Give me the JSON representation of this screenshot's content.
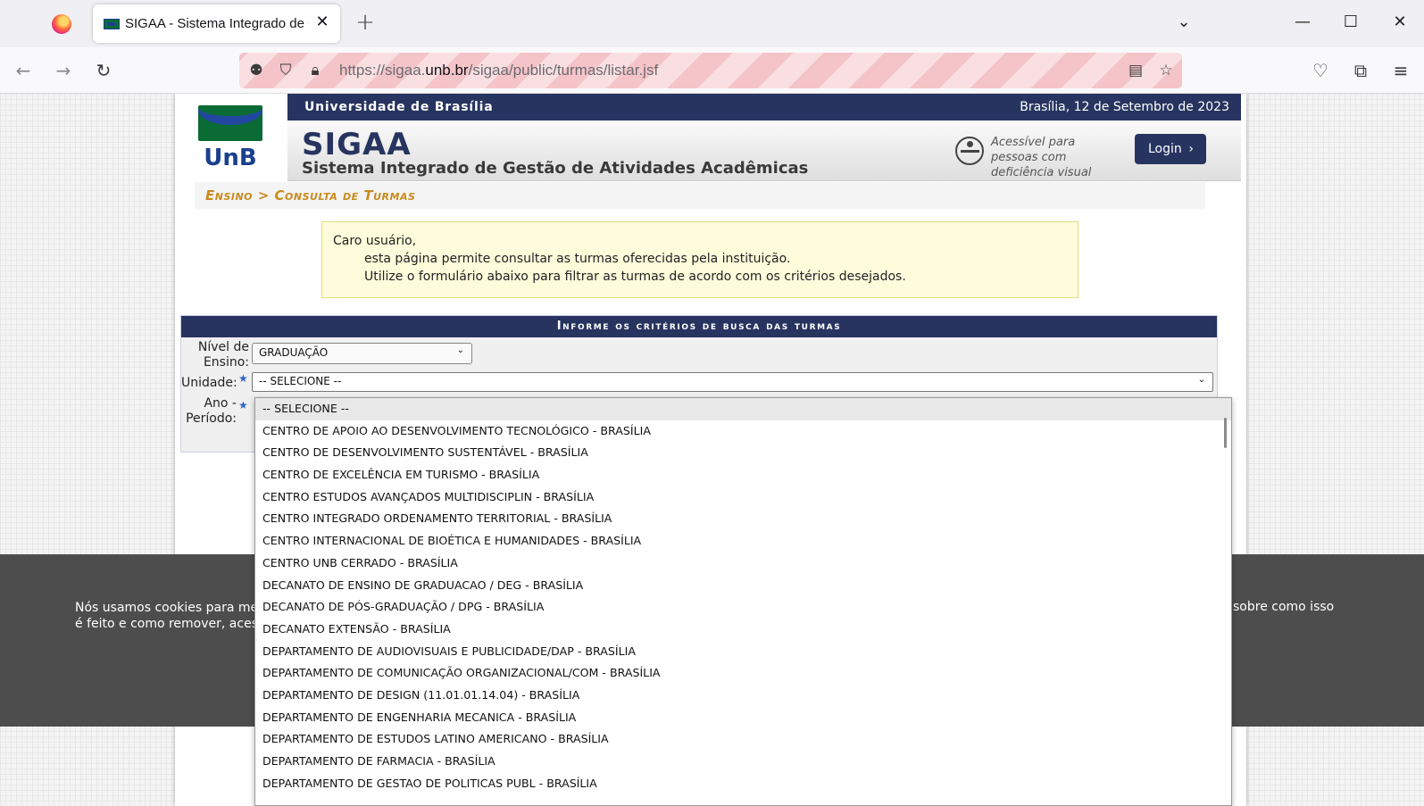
{
  "browser": {
    "tab_title": "SIGAA - Sistema Integrado de Gestão de Atividades Acadêmicas",
    "url_prefix": "https://sigaa.",
    "url_domain": "unb.br",
    "url_path": "/sigaa/public/turmas/listar.jsf"
  },
  "header": {
    "institution": "Universidade de Brasília",
    "date": "Brasília, 12 de Setembro de 2023",
    "logo_text": "UnB",
    "system_name": "SIGAA",
    "system_subtitle": "Sistema Integrado de Gestão de Atividades Acadêmicas",
    "accessibility_text": "Acessível para pessoas com deficiência visual",
    "login_label": "Login"
  },
  "breadcrumb": "Ensino > Consulta de Turmas",
  "notice": {
    "greeting": "Caro usuário,",
    "line1": "esta página permite consultar as turmas oferecidas pela instituição.",
    "line2": "Utilize o formulário abaixo para filtrar as turmas de acordo com os critérios desejados."
  },
  "form": {
    "title": "Informe os critérios de busca das turmas",
    "nivel_label_1": "Nível de",
    "nivel_label_2": "Ensino:",
    "nivel_value": "GRADUAÇÃO",
    "unidade_label": "Unidade:",
    "unidade_value": "-- SELECIONE --",
    "ano_label_1": "Ano -",
    "ano_label_2": "Período:"
  },
  "cookie": {
    "line1": "Nós usamos cookies para me",
    "line2": "é feito e como remover, aces",
    "tail": "sobre como isso"
  },
  "unidade_options": [
    "-- SELECIONE --",
    "CENTRO DE APOIO AO DESENVOLVIMENTO TECNOLÓGICO - BRASÍLIA",
    "CENTRO DE DESENVOLVIMENTO SUSTENTÁVEL - BRASÍLIA",
    "CENTRO DE EXCELÊNCIA EM TURISMO - BRASÍLIA",
    "CENTRO ESTUDOS AVANÇADOS MULTIDISCIPLIN - BRASÍLIA",
    "CENTRO INTEGRADO ORDENAMENTO TERRITORIAL - BRASÍLIA",
    "CENTRO INTERNACIONAL DE BIOÉTICA E HUMANIDADES - BRASÍLIA",
    "CENTRO UNB CERRADO - BRASÍLIA",
    "DECANATO DE ENSINO DE GRADUACAO / DEG - BRASÍLIA",
    "DECANATO DE PÓS-GRADUAÇÃO / DPG - BRASÍLIA",
    "DECANATO EXTENSÃO - BRASÍLIA",
    "DEPARTAMENTO DE AUDIOVISUAIS E PUBLICIDADE/DAP - BRASÍLIA",
    "DEPARTAMENTO DE COMUNICAÇÃO ORGANIZACIONAL/COM - BRASÍLIA",
    "DEPARTAMENTO DE DESIGN (11.01.01.14.04) - BRASÍLIA",
    "DEPARTAMENTO DE ENGENHARIA MECANICA - BRASÍLIA",
    "DEPARTAMENTO DE ESTUDOS LATINO AMERICANO - BRASÍLIA",
    "DEPARTAMENTO DE FARMACIA - BRASÍLIA",
    "DEPARTAMENTO DE GESTAO DE POLITICAS PUBL - BRASÍLIA"
  ]
}
